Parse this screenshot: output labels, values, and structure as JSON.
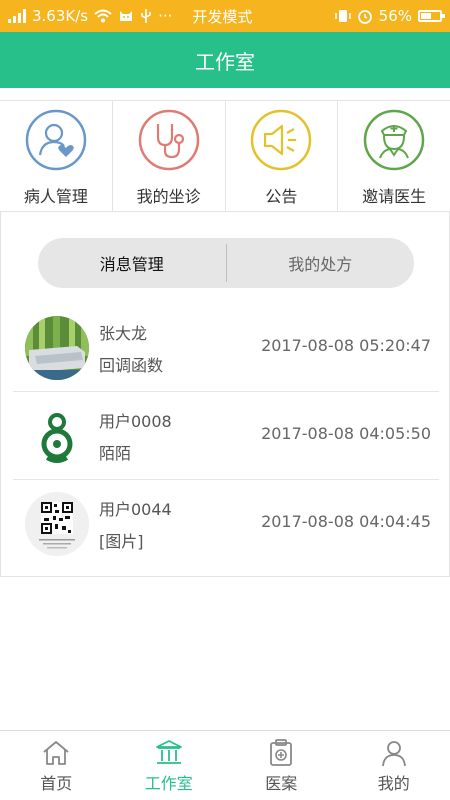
{
  "status_bar": {
    "speed": "3.63K/s",
    "icons_left": [
      "signal-icon",
      "wifi-icon",
      "cat-icon",
      "usb-icon"
    ],
    "dots": "···",
    "mode": "开发模式",
    "battery": "56%",
    "battery_level": 0.56
  },
  "title": "工作室",
  "quick_actions": [
    {
      "label": "病人管理",
      "icon": "patient-heart-icon",
      "color": "#6a97c9"
    },
    {
      "label": "我的坐诊",
      "icon": "stethoscope-icon",
      "color": "#e07b74"
    },
    {
      "label": "公告",
      "icon": "speaker-icon",
      "color": "#e2c229"
    },
    {
      "label": "邀请医生",
      "icon": "doctor-icon",
      "color": "#5ea64a"
    }
  ],
  "segment": {
    "active": "消息管理",
    "inactive": "我的处方"
  },
  "messages": [
    {
      "name": "张大龙",
      "preview": "回调函数",
      "time": "2017-08-08 05:20:47",
      "avatar": "sofa-photo"
    },
    {
      "name": "用户0008",
      "preview": "陌陌",
      "time": "2017-08-08 04:05:50",
      "avatar": "green-logo"
    },
    {
      "name": "用户0044",
      "preview": "[图片]",
      "time": "2017-08-08 04:04:45",
      "avatar": "qr-code"
    }
  ],
  "nav": [
    {
      "label": "首页",
      "icon": "home-icon"
    },
    {
      "label": "工作室",
      "icon": "studio-icon",
      "active": true
    },
    {
      "label": "医案",
      "icon": "medical-case-icon"
    },
    {
      "label": "我的",
      "icon": "profile-icon"
    }
  ],
  "colors": {
    "status_bar": "#f6b41e",
    "title_bar": "#28c08a",
    "accent": "#28c08a"
  }
}
